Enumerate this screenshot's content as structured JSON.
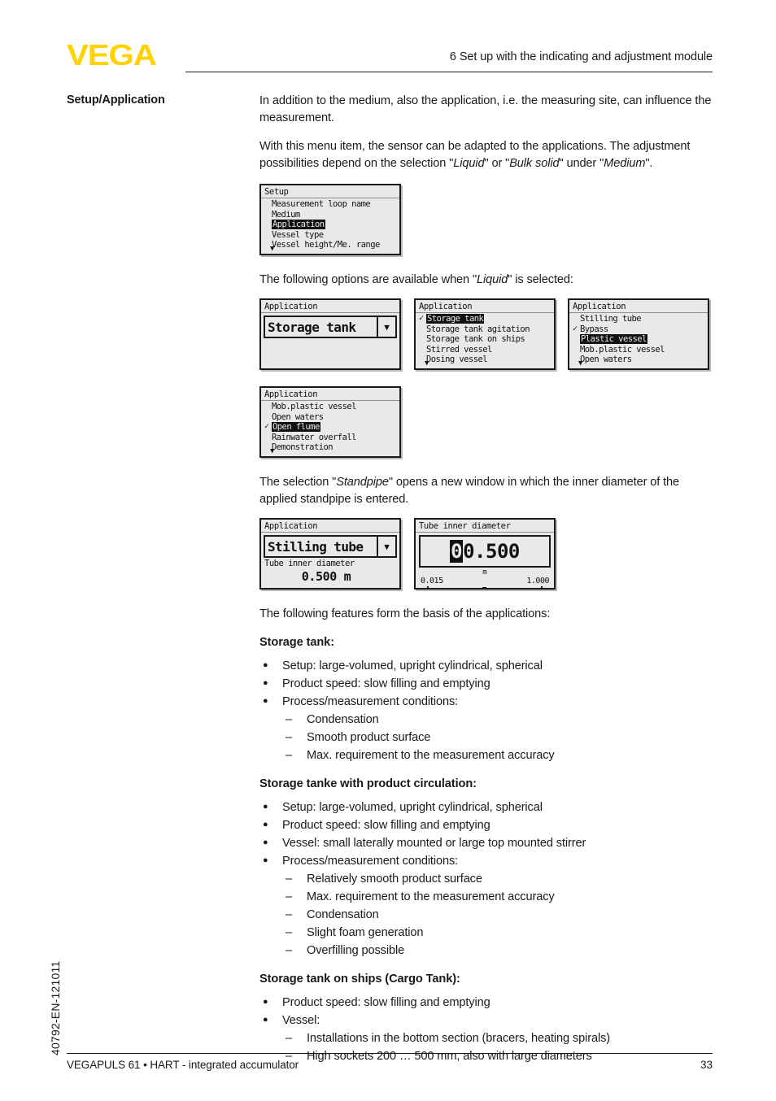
{
  "header": {
    "logo": "VEGA",
    "logo_color": "#FFD200",
    "chapter_title": "6 Set up with the indicating and adjustment module"
  },
  "side_code": "40792-EN-121011",
  "footer": {
    "left": "VEGAPULS 61 • HART - integrated accumulator",
    "page": "33"
  },
  "margin_label": "Setup/Application",
  "paragraphs": {
    "p1": "In addition to the medium, also the application, i.e. the measuring site, can influence the measurement.",
    "p2_a": "With this menu item, the sensor can be adapted to the applications. The adjustment possibilities depend on the selection \"",
    "p2_i1": "Liquid",
    "p2_b": "\" or \"",
    "p2_i2": "Bulk solid",
    "p2_c": "\" under \"",
    "p2_i3": "Medium",
    "p2_d": "\".",
    "p3_a": "The following options are available when \"",
    "p3_i": "Liquid",
    "p3_b": "\" is selected:",
    "p4_a": "The selection \"",
    "p4_i": "Standpipe",
    "p4_b": "\" opens a new window in which the inner diameter of the applied standpipe is entered.",
    "p5": "The following features form the basis of the applications:"
  },
  "lcd": {
    "setup_menu": {
      "title": "Setup",
      "items": [
        {
          "label": "Measurement loop name",
          "selected": false,
          "checked": false
        },
        {
          "label": "Medium",
          "selected": false,
          "checked": false
        },
        {
          "label": "Application",
          "selected": true,
          "checked": false
        },
        {
          "label": "Vessel type",
          "selected": false,
          "checked": false
        },
        {
          "label": "Vessel height/Me. range",
          "selected": false,
          "checked": false
        }
      ],
      "scroll_down": "▼"
    },
    "application_combo_storage": {
      "title": "Application",
      "value": "Storage tank",
      "arrow": "▼"
    },
    "application_list_1": {
      "title": "Application",
      "items": [
        {
          "label": "Storage tank",
          "selected": true,
          "checked": true
        },
        {
          "label": "Storage tank agitation",
          "selected": false,
          "checked": false
        },
        {
          "label": "Storage tank on ships",
          "selected": false,
          "checked": false
        },
        {
          "label": "Stirred vessel",
          "selected": false,
          "checked": false
        },
        {
          "label": "Dosing vessel",
          "selected": false,
          "checked": false
        }
      ],
      "scroll_down": "▼"
    },
    "application_list_2": {
      "title": "Application",
      "items": [
        {
          "label": "Stilling tube",
          "selected": false,
          "checked": false
        },
        {
          "label": "Bypass",
          "selected": false,
          "checked": true
        },
        {
          "label": "Plastic vessel",
          "selected": true,
          "checked": false
        },
        {
          "label": "Mob.plastic vessel",
          "selected": false,
          "checked": false
        },
        {
          "label": "Open waters",
          "selected": false,
          "checked": false
        }
      ],
      "scroll_down": "▼"
    },
    "application_list_3": {
      "title": "Application",
      "items": [
        {
          "label": "Mob.plastic vessel",
          "selected": false,
          "checked": false
        },
        {
          "label": "Open waters",
          "selected": false,
          "checked": false
        },
        {
          "label": "Open flume",
          "selected": true,
          "checked": true
        },
        {
          "label": "Rainwater overfall",
          "selected": false,
          "checked": false
        },
        {
          "label": "Demonstration",
          "selected": false,
          "checked": false
        }
      ],
      "scroll_down": "▼"
    },
    "stilling_tube": {
      "title": "Application",
      "value": "Stilling tube",
      "arrow": "▼",
      "sub_label": "Tube inner diameter",
      "sub_value": "0.500 m"
    },
    "tube_editor": {
      "title": "Tube inner diameter",
      "cursor_digit": "0",
      "rest_digits": "0.500",
      "unit": "m",
      "range_min": "0.015",
      "range_max": "1.000"
    }
  },
  "sections": [
    {
      "heading": "Storage tank:",
      "bullets": [
        {
          "text": "Setup: large-volumed, upright cylindrical, spherical",
          "subs": []
        },
        {
          "text": "Product speed: slow filling and emptying",
          "subs": []
        },
        {
          "text": "Process/measurement conditions:",
          "subs": [
            "Condensation",
            "Smooth product surface",
            "Max. requirement to the measurement accuracy"
          ]
        }
      ]
    },
    {
      "heading": "Storage tanke with product circulation:",
      "bullets": [
        {
          "text": "Setup: large-volumed, upright cylindrical, spherical",
          "subs": []
        },
        {
          "text": "Product speed: slow filling and emptying",
          "subs": []
        },
        {
          "text": "Vessel: small laterally mounted or large top mounted stirrer",
          "subs": []
        },
        {
          "text": "Process/measurement conditions:",
          "subs": [
            "Relatively smooth product surface",
            "Max. requirement to the measurement accuracy",
            "Condensation",
            "Slight foam generation",
            "Overfilling possible"
          ]
        }
      ]
    },
    {
      "heading": "Storage tank on ships (Cargo Tank):",
      "bullets": [
        {
          "text": "Product speed: slow filling and emptying",
          "subs": []
        },
        {
          "text": "Vessel:",
          "subs": [
            "Installations in the bottom section (bracers, heating spirals)",
            "High sockets 200 … 500 mm, also with large diameters"
          ]
        }
      ]
    }
  ]
}
